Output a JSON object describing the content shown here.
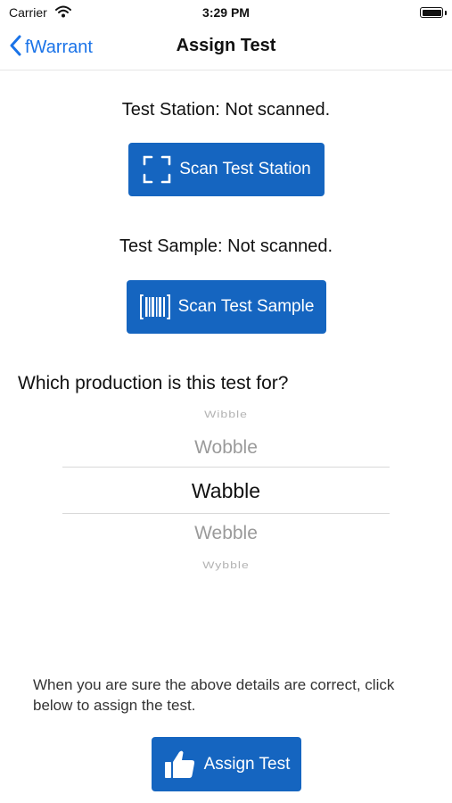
{
  "status_bar": {
    "carrier": "Carrier",
    "time": "3:29 PM",
    "wifi_icon": "wifi-icon",
    "battery_icon": "battery-icon"
  },
  "nav": {
    "back_label": "fWarrant",
    "back_icon": "chevron-left-icon",
    "title": "Assign Test"
  },
  "station": {
    "status": "Test Station: Not scanned.",
    "button_label": "Scan Test Station",
    "button_icon": "scan-frame-icon"
  },
  "sample": {
    "status": "Test Sample: Not scanned.",
    "button_label": "Scan Test Sample",
    "button_icon": "barcode-icon"
  },
  "production": {
    "question": "Which production is this test for?",
    "options": [
      "Wibble",
      "Wobble",
      "Wabble",
      "Webble",
      "Wybble"
    ],
    "selected": "Wabble"
  },
  "footer": {
    "instructions": "When you are sure the above details are correct, click below to assign the test.",
    "button_label": "Assign Test",
    "button_icon": "thumbs-up-icon"
  },
  "colors": {
    "accent": "#1565c0",
    "link": "#1a73e8"
  }
}
